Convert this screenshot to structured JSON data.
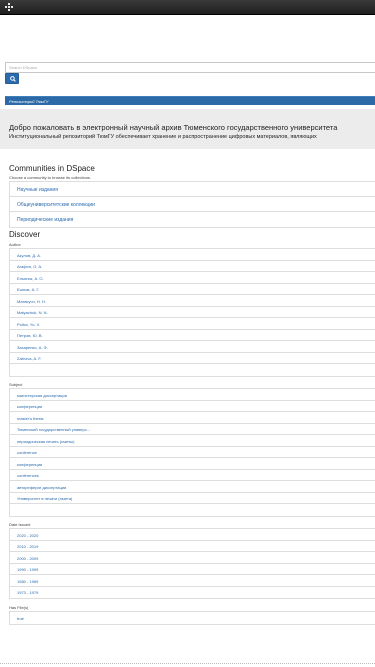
{
  "search": {
    "placeholder": "Search DSpace"
  },
  "breadcrumb": {
    "label": "Репозиторий ТюмГУ"
  },
  "welcome": {
    "title": "Добро пожаловать в электронный научный архив Тюменского государственного университета",
    "text": "Институциональный репозиторий ТюмГУ обеспечивает хранение и распространение цифровых материалов, являющих"
  },
  "communities": {
    "title": "Communities in DSpace",
    "subtitle": "Choose a community to browse its collections.",
    "items": [
      "Научные издания",
      "Общеуниверситетские коллекции",
      "Периодические издания"
    ]
  },
  "discover": {
    "title": "Discover",
    "author": {
      "label": "Author",
      "items": [
        "Акулов, Д. А.",
        "Агафон, О. А.",
        "Ельинск, А. О.",
        "Ешнов, А. Г.",
        "Матвсучп, Н. Н.",
        "Matyachuk, N. N.",
        "Pollov, Yu. V.",
        "Петров, Ю. В.",
        "Захаренко, А. Ф.",
        "Zaitrova, A. F.",
        ""
      ]
    },
    "subject": {
      "label": "Subject",
      "items": [
        "магистерская диссертация",
        "конференция",
        "master's thesis",
        "Тюменский государственный универс...",
        "периодическая печать (газеты)",
        "conference",
        "конференции",
        "conferences",
        "автореферат диссертации",
        "Университет в печати (газета)",
        ""
      ]
    },
    "date_issued": {
      "label": "Date Issued",
      "items": [
        "2020 - 2020",
        "2010 - 2019",
        "2000 - 2009",
        "1990 - 1999",
        "1980 - 1989",
        "1973 - 1979"
      ]
    },
    "has_files": {
      "label": "Has File(s)",
      "items": [
        "true"
      ]
    }
  }
}
